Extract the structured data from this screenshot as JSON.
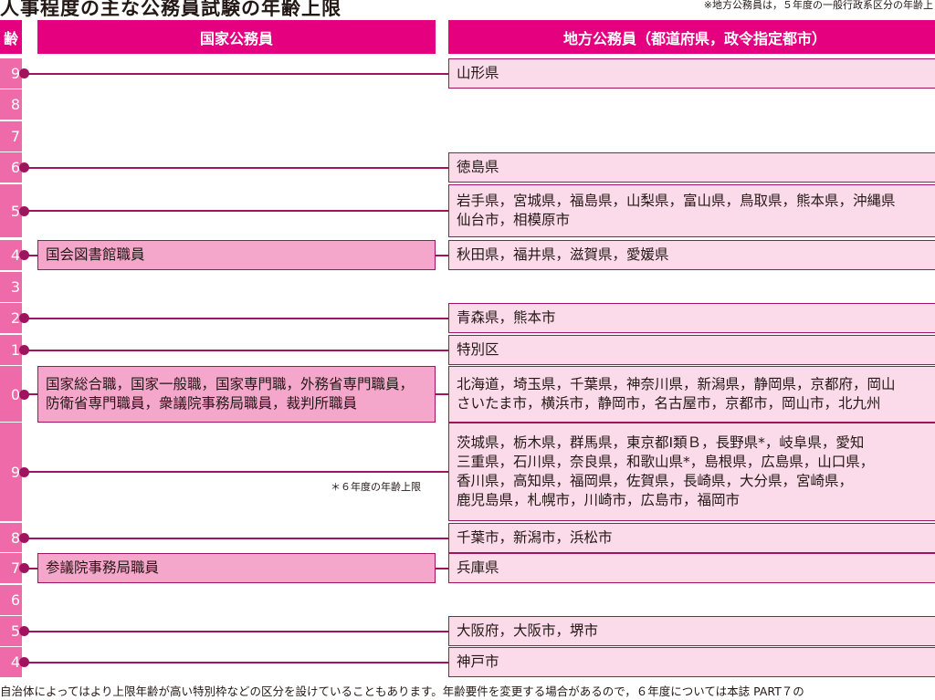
{
  "title": "人事程度の主な公務員試験の年齢上限",
  "top_note": "※地方公務員は，５年度の一般行政系区分の年齢上",
  "headers": {
    "age": "齢",
    "national": "国家公務員",
    "local": "地方公務員（都道府県，政令指定都市）"
  },
  "rows": [
    {
      "age": "9",
      "national": [],
      "local": [
        "山形県"
      ]
    },
    {
      "age": "8",
      "national": [],
      "local": []
    },
    {
      "age": "7",
      "national": [],
      "local": []
    },
    {
      "age": "6",
      "national": [],
      "local": [
        "徳島県"
      ]
    },
    {
      "age": "5",
      "national": [],
      "local": [
        "岩手県，宮城県，福島県，山梨県，富山県，鳥取県，熊本県，沖縄県",
        "仙台市，相模原市"
      ]
    },
    {
      "age": "4",
      "national": [
        "国会図書館職員"
      ],
      "local": [
        "秋田県，福井県，滋賀県，愛媛県"
      ]
    },
    {
      "age": "3",
      "national": [],
      "local": []
    },
    {
      "age": "2",
      "national": [],
      "local": [
        "青森県，熊本市"
      ]
    },
    {
      "age": "1",
      "national": [],
      "local": [
        "特別区"
      ]
    },
    {
      "age": "0",
      "national": [
        "国家総合職，国家一般職，国家専門職，外務省専門職員，",
        "防衛省専門職員，衆議院事務局職員，裁判所職員"
      ],
      "local": [
        "北海道，埼玉県，千葉県，神奈川県，新潟県，静岡県，京都府，岡山",
        "さいたま市，横浜市，静岡市，名古屋市，京都市，岡山市，北九州"
      ]
    },
    {
      "age": "9",
      "national": [],
      "local": [
        "茨城県，栃木県，群馬県，東京都Ⅰ類Ｂ，長野県*，岐阜県，愛知",
        "三重県，石川県，奈良県，和歌山県*，島根県，広島県，山口県，",
        "香川県，高知県，福岡県，佐賀県，長崎県，大分県，宮崎県，",
        "鹿児島県，札幌市，川崎市，広島市，福岡市"
      ]
    },
    {
      "age": "8",
      "national": [],
      "local": [
        "千葉市，新潟市，浜松市"
      ]
    },
    {
      "age": "7",
      "national": [
        "参議院事務局職員"
      ],
      "local": [
        "兵庫県"
      ]
    },
    {
      "age": "6",
      "national": [],
      "local": []
    },
    {
      "age": "5",
      "national": [],
      "local": [
        "大阪府，大阪市，堺市"
      ]
    },
    {
      "age": "4",
      "national": [],
      "local": [
        "神戸市"
      ]
    }
  ],
  "mid_note": "＊６年度の年齢上限",
  "footnote": "自治体によってはより上限年齢が高い特別枠などの区分を設けていることもあります。年齢要件を変更する場合があるので，６年度については本誌 PART７の",
  "colors": {
    "header": "#e5007f",
    "age_band": "#ef6aa8",
    "national_box": "#f4a6cb",
    "local_box": "#fbdbea",
    "line": "#a0145f"
  }
}
